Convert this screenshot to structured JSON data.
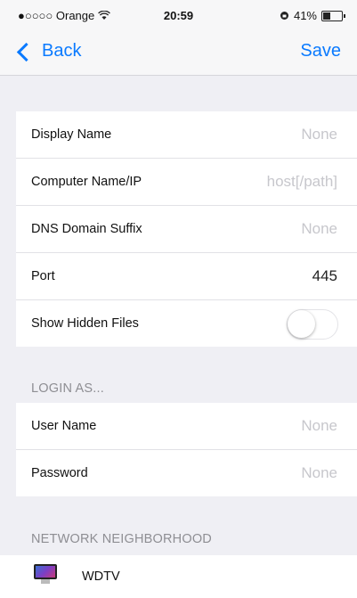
{
  "status_bar": {
    "carrier": "●○○○○ Orange",
    "wifi_icon": "wifi-icon",
    "time": "20:59",
    "lock_icon": "rotation-lock-icon",
    "battery_percent": "41%",
    "battery_level": 0.41
  },
  "nav": {
    "back_label": "Back",
    "save_label": "Save"
  },
  "settings": {
    "rows": [
      {
        "label": "Display Name",
        "value": "None"
      },
      {
        "label": "Computer Name/IP",
        "value": "host[/path]"
      },
      {
        "label": "DNS Domain Suffix",
        "value": "None"
      },
      {
        "label": "Port",
        "value": "445"
      },
      {
        "label": "Show Hidden Files",
        "toggle": false
      }
    ]
  },
  "login": {
    "title": "LOGIN AS...",
    "rows": [
      {
        "label": "User Name",
        "value": "None"
      },
      {
        "label": "Password",
        "value": "None"
      }
    ]
  },
  "network": {
    "title": "NETWORK NEIGHBORHOOD",
    "items": [
      {
        "label": "WDTV",
        "icon": "imac-icon"
      }
    ]
  },
  "colors": {
    "accent": "#0a7aff",
    "background": "#efeff4",
    "placeholder": "#c7c7cc"
  }
}
